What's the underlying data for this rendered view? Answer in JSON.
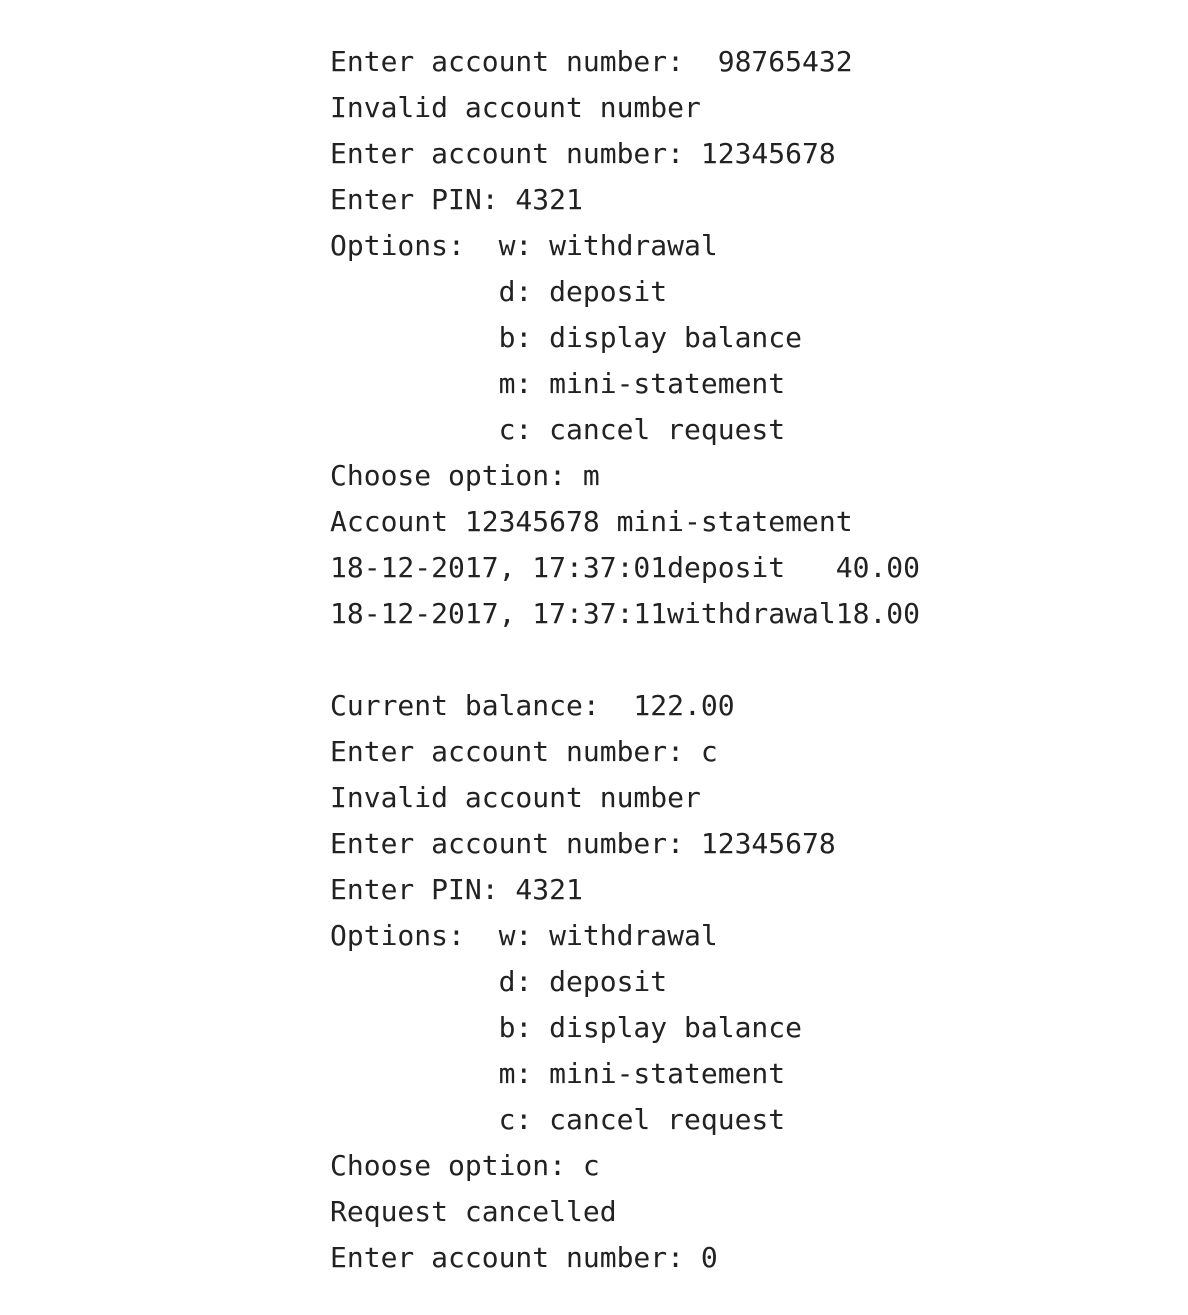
{
  "console": {
    "lines": [
      "Enter account number:  98765432",
      "Invalid account number",
      "Enter account number: 12345678",
      "Enter PIN: 4321",
      "Options:  w: withdrawal",
      "          d: deposit",
      "          b: display balance",
      "          m: mini-statement",
      "          c: cancel request",
      "Choose option: m",
      "Account 12345678 mini-statement",
      "18-12-2017, 17:37:01deposit   40.00",
      "18-12-2017, 17:37:11withdrawal18.00",
      "",
      "Current balance:  122.00",
      "Enter account number: c",
      "Invalid account number",
      "Enter account number: 12345678",
      "Enter PIN: 4321",
      "Options:  w: withdrawal",
      "          d: deposit",
      "          b: display balance",
      "          m: mini-statement",
      "          c: cancel request",
      "Choose option: c",
      "Request cancelled",
      "Enter account number: 0"
    ]
  }
}
